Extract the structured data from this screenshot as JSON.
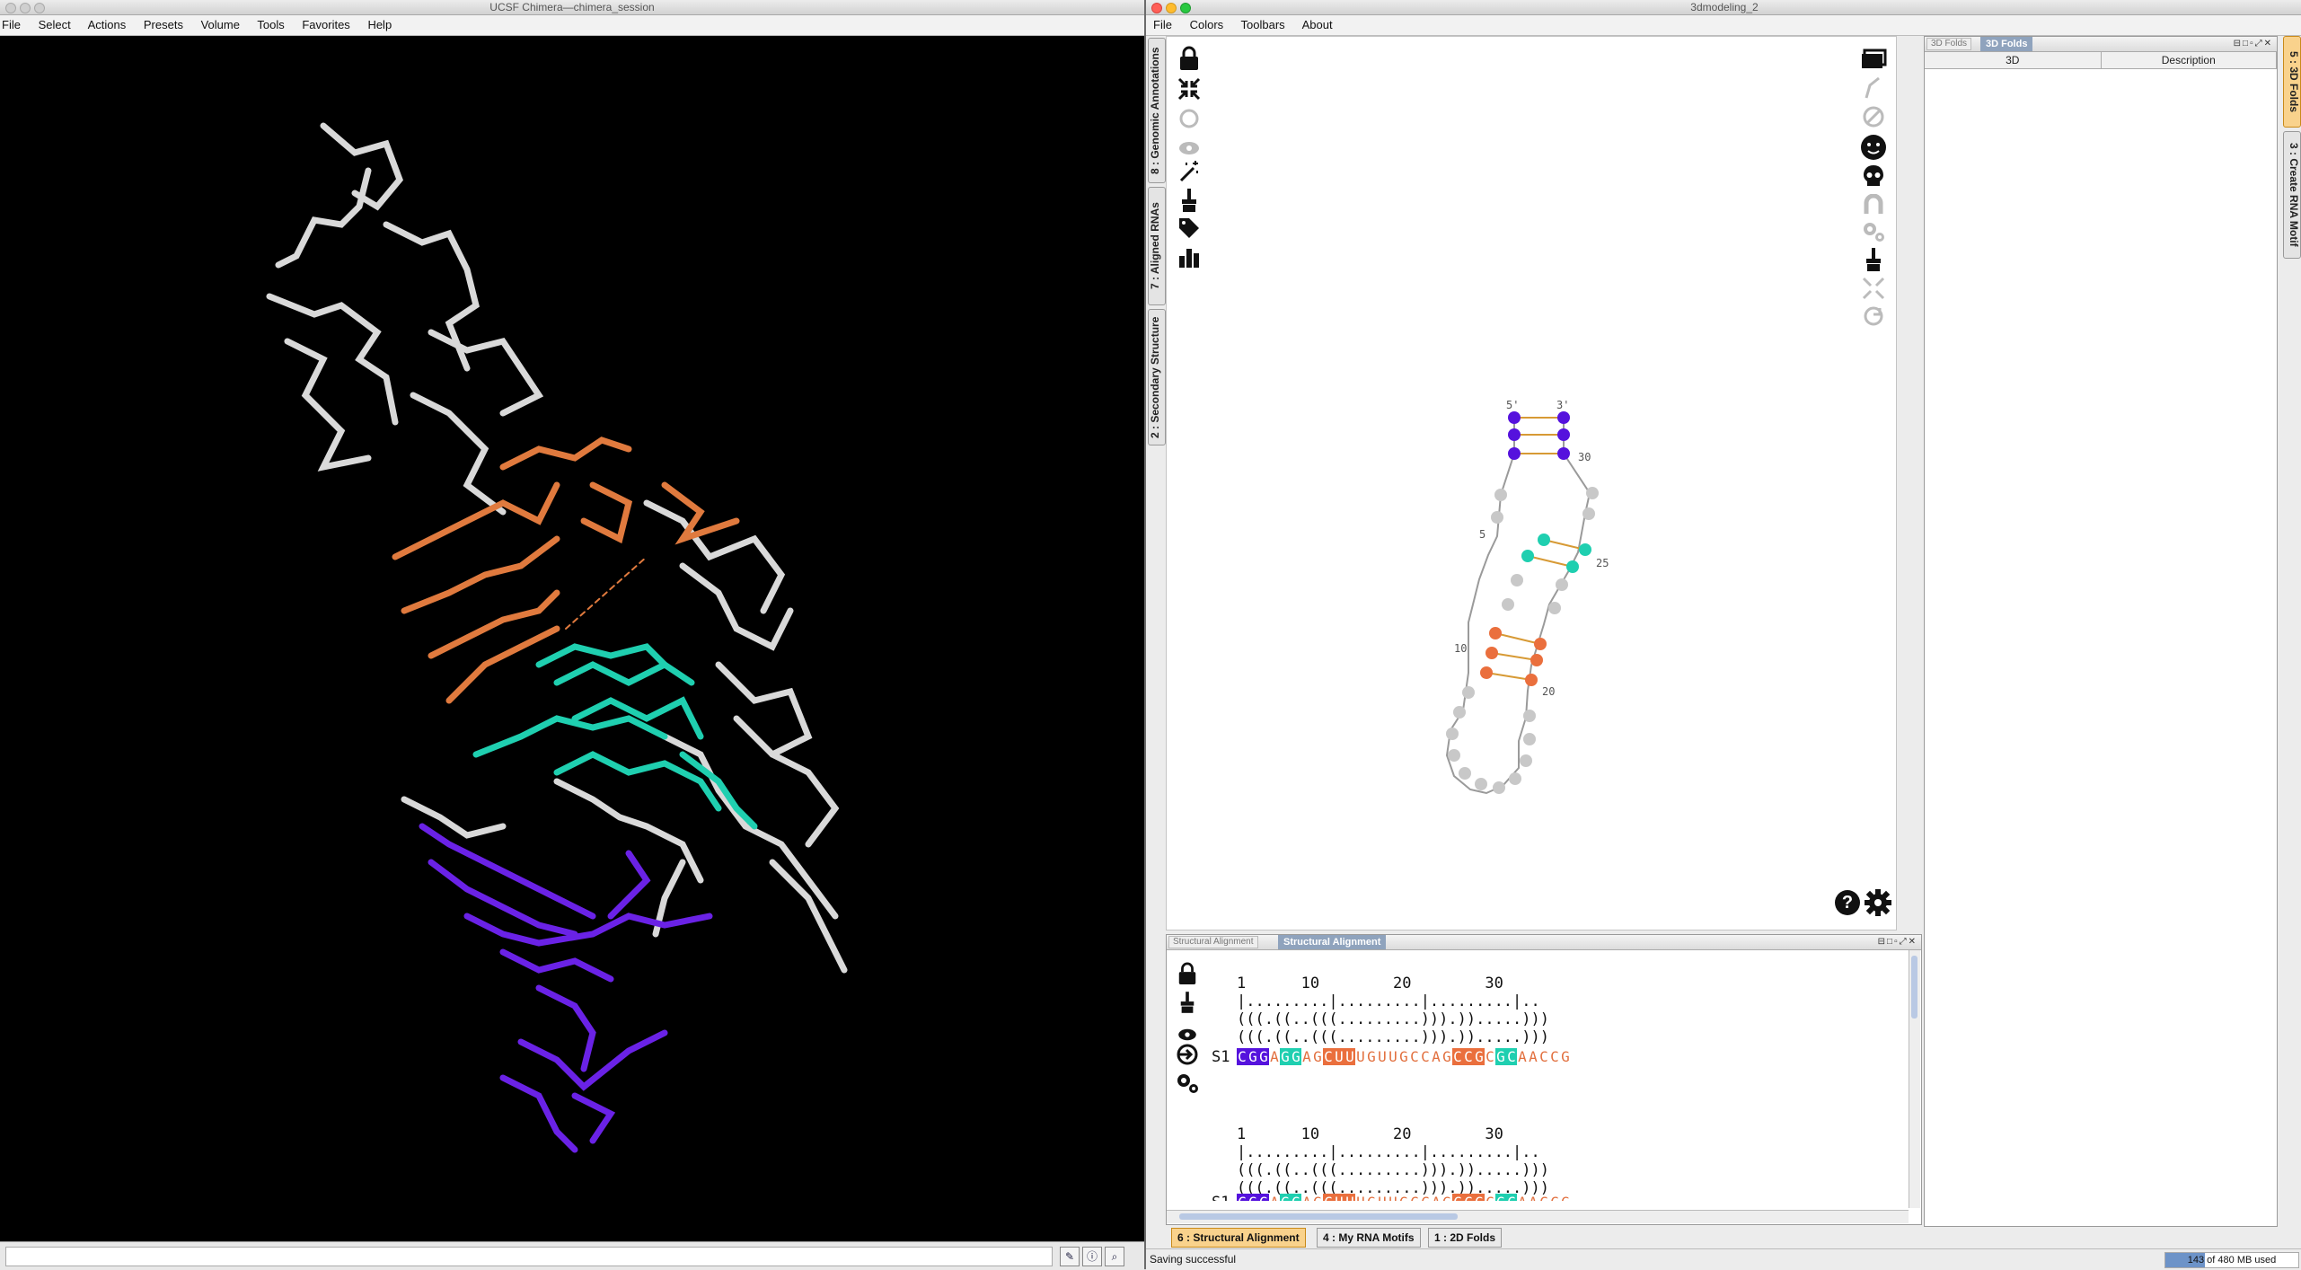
{
  "chimera": {
    "title": "UCSF Chimera—chimera_session",
    "menu": [
      "File",
      "Select",
      "Actions",
      "Presets",
      "Volume",
      "Tools",
      "Favorites",
      "Help"
    ],
    "command_value": ""
  },
  "app": {
    "title": "3dmodeling_2",
    "menu": [
      "File",
      "Colors",
      "Toolbars",
      "About"
    ],
    "left_tabs": [
      "8 : Genomic Annotations",
      "7 : Aligned RNAs",
      "2 : Secondary Structure"
    ],
    "right_tabs": [
      "5 : 3D Folds",
      "3 : Create RNA Motif"
    ],
    "folds_panel": {
      "ghost_tab": "3D Folds",
      "title": "3D Folds",
      "columns": [
        "3D",
        "Description"
      ]
    },
    "alignment_panel": {
      "ghost_tab": "Structural Alignment",
      "title": "Structural Alignment",
      "ruler": "1      10        20        30",
      "ticks": "|.........|.........|.........|..",
      "bracket1": "(((.((..(((.........))).)).....)))",
      "bracket2": "(((.((..(((.........))).)).....)))",
      "seq_label": "S1",
      "sequence": "CGGAGGAGCUUUGUUGCCAGCCGCGCAACCG"
    },
    "structure_labels": {
      "five_prime": "5'",
      "three_prime": "3'",
      "n5": "5",
      "n10": "10",
      "n20": "20",
      "n25": "25",
      "n30": "30"
    },
    "bottom_tabs": [
      "6 : Structural Alignment",
      "4 : My RNA Motifs",
      "1 : 2D Folds"
    ],
    "status": "Saving successful",
    "memory": "143 of 480 MB used"
  },
  "colors": {
    "purple": "#5512dd",
    "teal": "#1fcfb0",
    "orange": "#ea6f3d",
    "grey_node": "#c8c8c8",
    "panel_title_bg": "#8fa3bd",
    "active_tab": "#f9d28c"
  },
  "icons": {
    "left_toolbar": [
      "lock-icon",
      "collapse-icon",
      "refresh-icon",
      "eye-icon",
      "magic-wand-icon",
      "paint-brush-icon",
      "tag-icon",
      "bar-chart-icon"
    ],
    "right_toolbar": [
      "window-icon",
      "pen-icon",
      "forbidden-icon",
      "smiley-icon",
      "skull-icon",
      "magnet-icon",
      "gears-icon",
      "paint-brush-icon",
      "collapse-icon",
      "refresh-icon"
    ],
    "alignment_toolbar": [
      "lock-icon",
      "paint-brush-icon",
      "eye-icon",
      "sign-in-icon",
      "gears-icon"
    ]
  }
}
